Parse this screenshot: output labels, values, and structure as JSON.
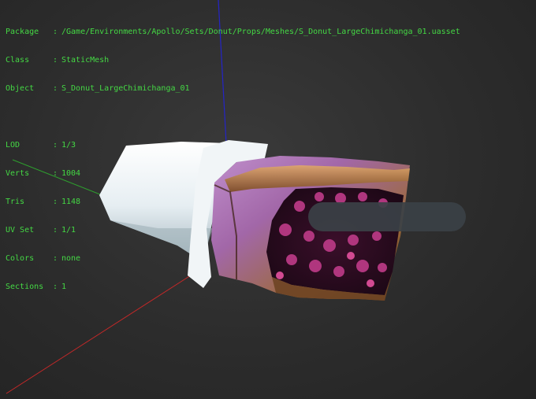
{
  "info": {
    "package_label": "Package",
    "package_value": "/Game/Environments/Apollo/Sets/Donut/Props/Meshes/S_Donut_LargeChimichanga_01.uasset",
    "class_label": "Class",
    "class_value": "StaticMesh",
    "object_label": "Object",
    "object_value": "S_Donut_LargeChimichanga_01",
    "lod_label": "LOD",
    "lod_value": "1/3",
    "verts_label": "Verts",
    "verts_value": "1004",
    "tris_label": "Tris",
    "tris_value": "1148",
    "uvset_label": "UV Set",
    "uvset_value": "1/1",
    "colors_label": "Colors",
    "colors_value": "none",
    "sections_label": "Sections",
    "sections_value": "1",
    "separator": ":"
  },
  "colors": {
    "overlay_text": "#44d844",
    "axis_x": "#c62828",
    "axis_y": "#2e9e2e",
    "axis_z": "#2424c8",
    "background": "#2c2c2c"
  }
}
